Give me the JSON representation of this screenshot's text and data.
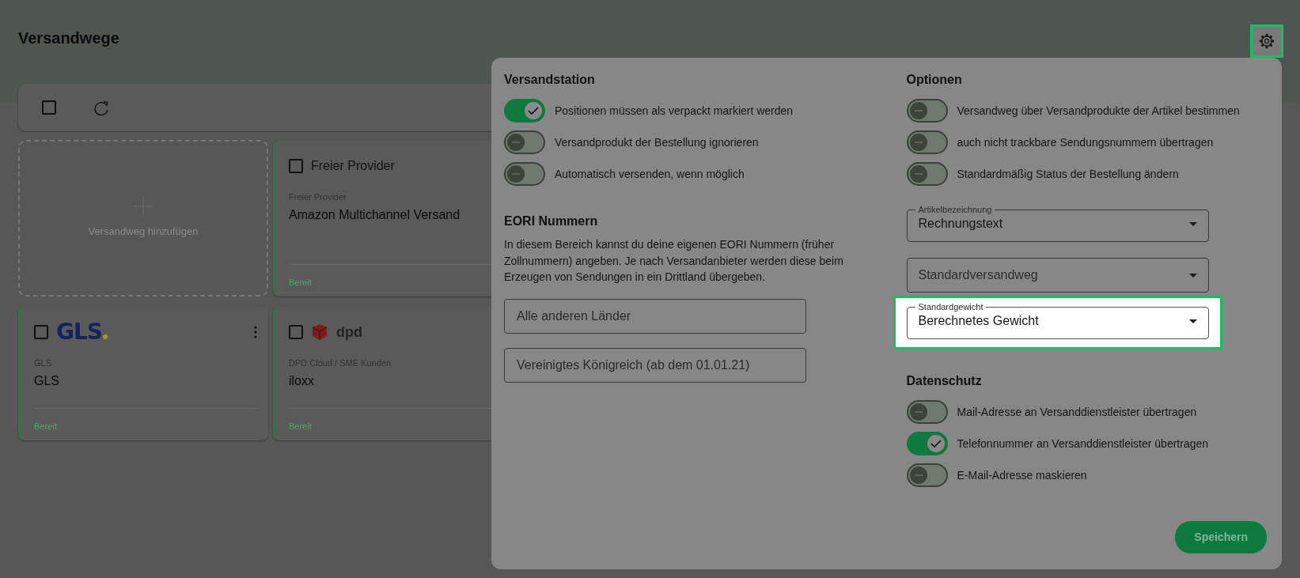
{
  "page": {
    "title": "Versandwege"
  },
  "settings_button": {
    "highlighted": true
  },
  "toolbar": {
    "select_all_checked": false
  },
  "cards": [
    {
      "kind": "add",
      "label": "Versandweg hinzufügen"
    },
    {
      "kind": "provider",
      "logo": {
        "kind": "text",
        "text": "Freier Provider"
      },
      "checked": false,
      "provider": "Freier Provider",
      "name": "Amazon Multichannel Versand",
      "status": "Bereit"
    },
    {
      "kind": "provider",
      "logo": {
        "kind": "gls",
        "text": "GLS"
      },
      "checked": false,
      "provider": "GLS",
      "name": "GLS",
      "status": "Bereit"
    },
    {
      "kind": "provider",
      "logo": {
        "kind": "dpd",
        "text": "dpd"
      },
      "checked": false,
      "provider": "DPD Cloud / SME Kunden",
      "name": "iloxx",
      "status": "Bereit"
    }
  ],
  "dialog": {
    "columns": [
      [
        {
          "title": "Versandstation",
          "items": [
            {
              "kind": "toggle",
              "label": "Positionen müssen als verpackt markiert werden",
              "on": true
            },
            {
              "kind": "toggle",
              "label": "Versandprodukt der Bestellung ignorieren",
              "on": false
            },
            {
              "kind": "toggle",
              "label": "Automatisch versenden, wenn möglich",
              "on": false
            }
          ]
        },
        {
          "title": "EORI Nummern",
          "items": [
            {
              "kind": "text",
              "text": "In diesem Bereich kannst du deine eigenen EORI Nummern (früher Zollnummern) angeben. Je nach Versandanbieter werden diese beim Erzeugen von Sendungen in ein Drittland übergeben."
            },
            {
              "kind": "input",
              "placeholder": "Alle anderen Länder"
            },
            {
              "kind": "input",
              "placeholder": "Vereinigtes Königreich (ab dem 01.01.21)"
            }
          ]
        }
      ],
      [
        {
          "title": "Optionen",
          "items": [
            {
              "kind": "toggle",
              "label": "Versandweg über Versandprodukte der Artikel bestimmen",
              "on": false
            },
            {
              "kind": "toggle",
              "label": "auch nicht trackbare Sendungsnummern übertragen",
              "on": false
            },
            {
              "kind": "toggle",
              "label": "Standardmäßig Status der Bestellung ändern",
              "on": false
            },
            {
              "kind": "select",
              "label": "Artikelbezeichnung",
              "value": "Rechnungstext",
              "highlighted": false
            },
            {
              "kind": "select",
              "placeholder": "Standardversandweg",
              "highlighted": false
            },
            {
              "kind": "select",
              "label": "Standardgewicht",
              "value": "Berechnetes Gewicht",
              "highlighted": true
            }
          ]
        },
        {
          "title": "Datenschutz",
          "items": [
            {
              "kind": "toggle",
              "label": "Mail-Adresse an Versanddienstleister übertragen",
              "on": false
            },
            {
              "kind": "toggle",
              "label": "Telefonnummer an Versanddienstleister übertragen",
              "on": true
            },
            {
              "kind": "toggle",
              "label": "E-Mail-Adresse maskieren",
              "on": false
            }
          ]
        }
      ]
    ],
    "save_button": "Speichern"
  }
}
